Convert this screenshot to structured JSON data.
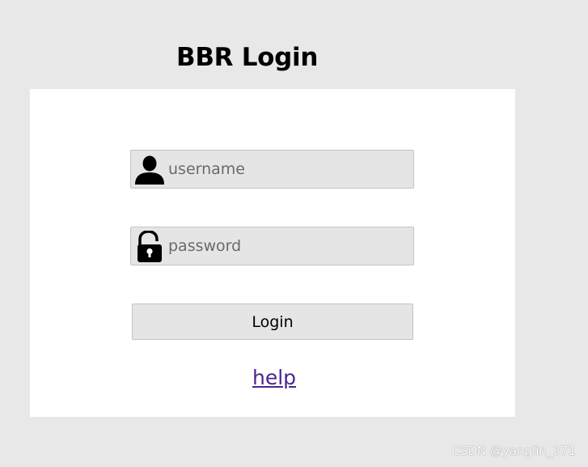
{
  "page": {
    "title": "BBR Login"
  },
  "form": {
    "username": {
      "icon": "user-icon",
      "placeholder": "username",
      "value": ""
    },
    "password": {
      "icon": "lock-icon",
      "placeholder": "password",
      "value": ""
    },
    "login_label": "Login",
    "help_label": "help"
  },
  "watermark": "CSDN @yanglin_371",
  "colors": {
    "background": "#e8e8e8",
    "panel": "#ffffff",
    "field": "#e5e5e5",
    "link": "#4b2592"
  }
}
